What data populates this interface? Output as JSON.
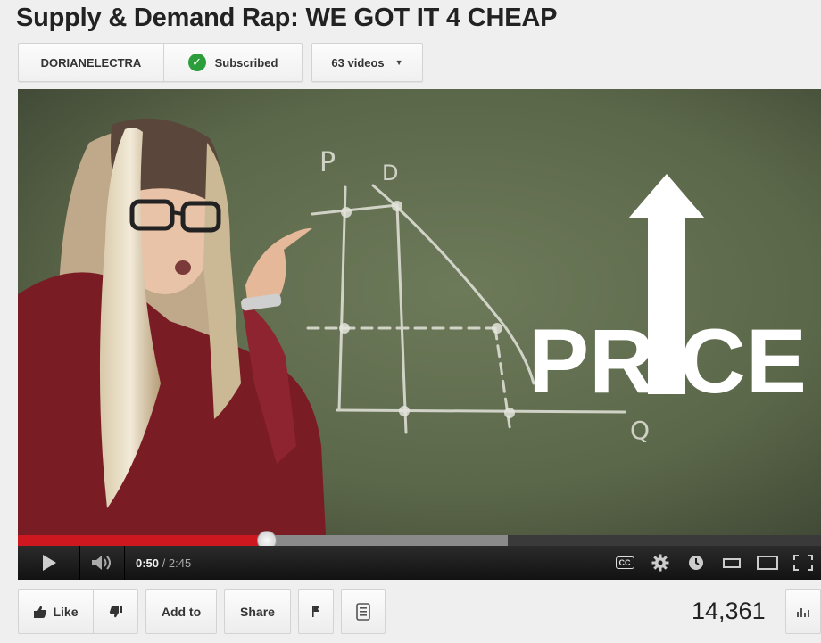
{
  "video": {
    "title": "Supply & Demand Rap: WE GOT IT 4 CHEAP"
  },
  "channel": {
    "name": "DORIANELECTRA",
    "subscribe_label": "Subscribed",
    "videos_label": "63 videos"
  },
  "frame": {
    "axis_p": "P",
    "axis_d": "D",
    "axis_q": "Q",
    "overlay_text": "PRICE"
  },
  "player": {
    "current_time": "0:50",
    "duration": "2:45",
    "duration_display": "/ 2:45",
    "progress_fraction": 0.31,
    "buffered_fraction": 0.61,
    "cc_label": "CC"
  },
  "actions": {
    "like_label": "Like",
    "add_to_label": "Add to",
    "share_label": "Share"
  },
  "stats": {
    "view_count": "14,361"
  },
  "colors": {
    "progress_red": "#cc181e",
    "subscribed_green": "#2b9d3a",
    "chalkboard": "#5f6b4c"
  },
  "icons": {
    "subscribed": "check-icon",
    "videos_dropdown": "caret-down-icon",
    "play": "play-icon",
    "volume": "volume-icon",
    "captions": "cc-icon",
    "settings": "gear-icon",
    "watch_later": "clock-icon",
    "small_player": "small-player-icon",
    "large_player": "large-player-icon",
    "fullscreen": "fullscreen-icon",
    "like": "thumbs-up-icon",
    "dislike": "thumbs-down-icon",
    "flag": "flag-icon",
    "transcript": "transcript-icon",
    "stats": "stats-icon"
  }
}
